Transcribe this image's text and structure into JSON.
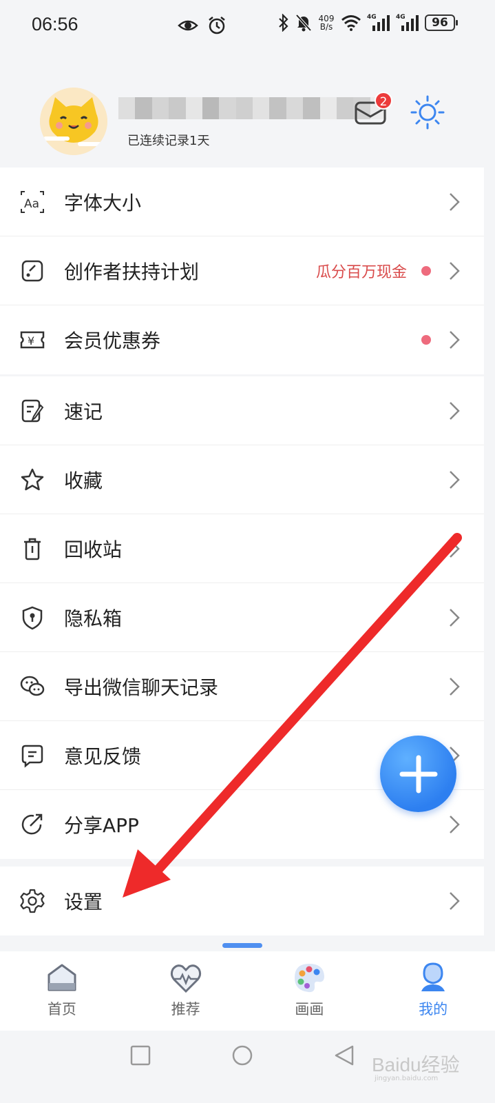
{
  "status_bar": {
    "time": "06:56",
    "net_speed_value": "409",
    "net_speed_unit": "B/s",
    "signal_1_label": "4G",
    "signal_2_label": "4G",
    "battery": "96",
    "icons": [
      "eye-icon",
      "alarm-icon",
      "bluetooth-icon",
      "mute-bell-icon",
      "wifi-icon",
      "signal-icon",
      "signal-icon",
      "battery-icon"
    ]
  },
  "profile": {
    "streak_text": "已连续记录1天",
    "message_badge_count": "2"
  },
  "menu_group_1": [
    {
      "label": "字体大小",
      "icon": "font-size-icon"
    },
    {
      "label": "创作者扶持计划",
      "icon": "creator-icon",
      "extra": "瓜分百万现金",
      "dot": true
    },
    {
      "label": "会员优惠券",
      "icon": "coupon-icon",
      "dot": true
    }
  ],
  "menu_group_2": [
    {
      "label": "速记",
      "icon": "quick-note-icon"
    },
    {
      "label": "收藏",
      "icon": "star-icon"
    },
    {
      "label": "回收站",
      "icon": "trash-icon"
    },
    {
      "label": "隐私箱",
      "icon": "privacy-shield-icon"
    },
    {
      "label": "导出微信聊天记录",
      "icon": "wechat-icon"
    },
    {
      "label": "意见反馈",
      "icon": "feedback-icon"
    },
    {
      "label": "分享APP",
      "icon": "share-icon"
    }
  ],
  "menu_group_3": [
    {
      "label": "设置",
      "icon": "gear-icon"
    }
  ],
  "bottom_nav": [
    {
      "label": "首页",
      "icon": "home-icon"
    },
    {
      "label": "推荐",
      "icon": "heart-pulse-icon"
    },
    {
      "label": "画画",
      "icon": "palette-icon"
    },
    {
      "label": "我的",
      "icon": "profile-icon",
      "active": true
    }
  ],
  "watermark": {
    "brand": "Baidu经验",
    "url": "jingyan.baidu.com"
  },
  "colors": {
    "accent": "#3c86f0",
    "promo_text": "#d94b4b",
    "dot": "#ee6b7d",
    "badge": "#ec3b3b",
    "annotation_arrow": "#ee2a2a"
  }
}
